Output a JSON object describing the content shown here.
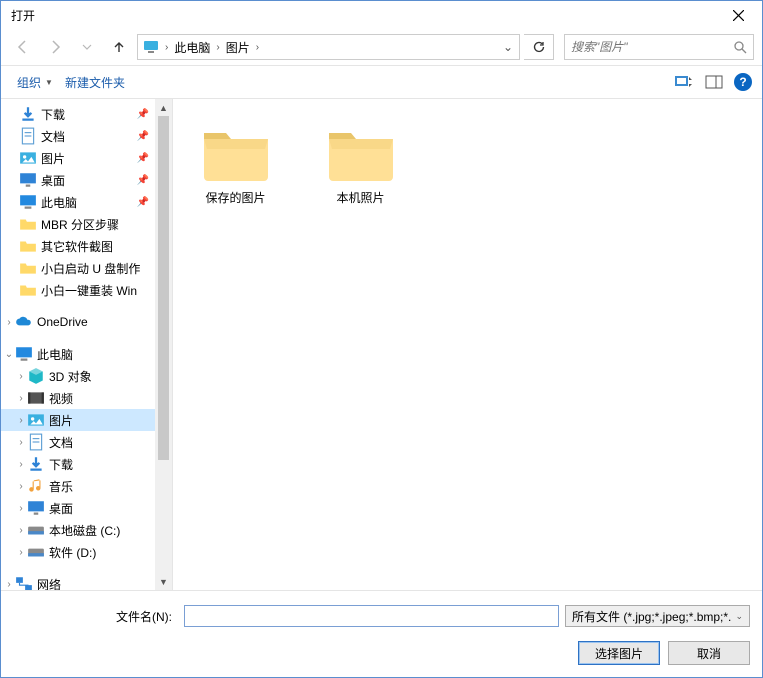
{
  "title": "打开",
  "breadcrumb": {
    "seg1": "此电脑",
    "seg2": "图片"
  },
  "search": {
    "placeholder": "搜索\"图片\""
  },
  "toolbar": {
    "organize": "组织",
    "newfolder": "新建文件夹"
  },
  "sidebar": {
    "downloads": "下载",
    "documents": "文档",
    "pictures": "图片",
    "desktop": "桌面",
    "thispc_qa": "此电脑",
    "mbr": "MBR 分区步骤",
    "other_screenshots": "其它软件截图",
    "xiaobai_usb": "小白启动 U 盘制作",
    "xiaobai_reinstall": "小白一键重装 Win",
    "onedrive": "OneDrive",
    "thispc": "此电脑",
    "objects3d": "3D 对象",
    "videos": "视频",
    "pictures2": "图片",
    "documents2": "文档",
    "downloads2": "下载",
    "music": "音乐",
    "desktop2": "桌面",
    "diskc": "本地磁盘 (C:)",
    "diskd": "软件 (D:)",
    "network": "网络"
  },
  "content": {
    "folder1": "保存的图片",
    "folder2": "本机照片"
  },
  "bottom": {
    "filename_label": "文件名(N):",
    "filename_value": "",
    "filter": "所有文件 (*.jpg;*.jpeg;*.bmp;*.",
    "open": "选择图片",
    "cancel": "取消"
  }
}
